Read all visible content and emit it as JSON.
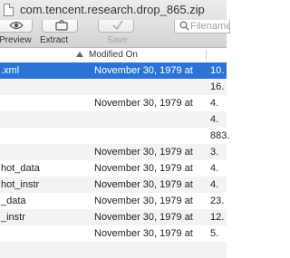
{
  "window": {
    "title": "com.tencent.research.drop_865.zip"
  },
  "toolbar": {
    "preview_label": "Preview",
    "extract_label": "Extract",
    "save_label": "Save",
    "search_placeholder": "Filename"
  },
  "columns": {
    "modified_on": "Modified On"
  },
  "rows": [
    {
      "name": ".xml",
      "date": "November 30, 1979 at",
      "size": "10.",
      "selected": true
    },
    {
      "name": "",
      "date": "",
      "size": "16."
    },
    {
      "name": "",
      "date": "November 30, 1979 at",
      "size": "4."
    },
    {
      "name": "",
      "date": "",
      "size": "4."
    },
    {
      "name": "",
      "date": "",
      "size": "883."
    },
    {
      "name": "",
      "date": "November 30, 1979 at",
      "size": "3."
    },
    {
      "name": "hot_data",
      "date": "November 30, 1979 at",
      "size": "4."
    },
    {
      "name": "hot_instr",
      "date": "November 30, 1979 at",
      "size": "4."
    },
    {
      "name": "_data",
      "date": "November 30, 1979 at",
      "size": "23."
    },
    {
      "name": "_instr",
      "date": "November 30, 1979 at",
      "size": "12."
    },
    {
      "name": "",
      "date": "November 30, 1979 at",
      "size": "5."
    },
    {
      "name": "",
      "date": "",
      "size": ""
    }
  ]
}
